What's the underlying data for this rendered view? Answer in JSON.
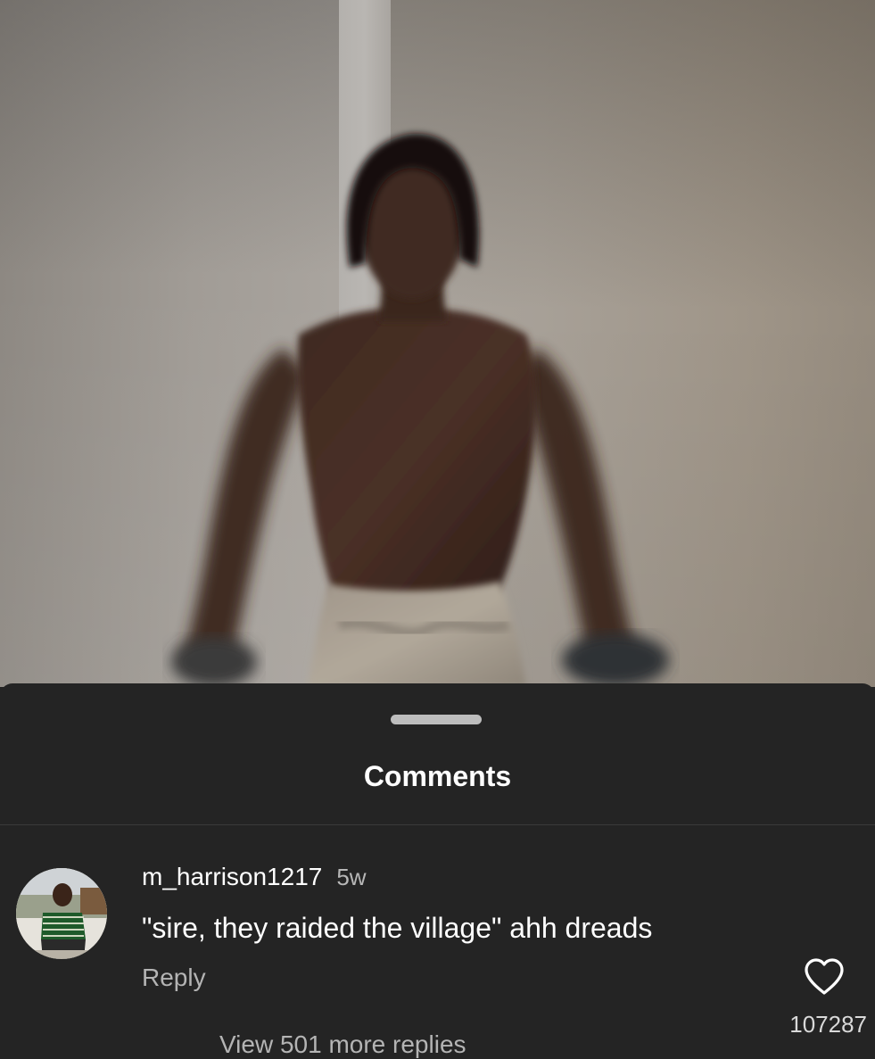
{
  "sheet": {
    "title": "Comments"
  },
  "comments": [
    {
      "username": "m_harrison1217",
      "time": "5w",
      "text": "\"sire, they raided the village\" ahh dreads",
      "reply_label": "Reply",
      "like_count": "107287",
      "like_icon": "heart-outline-icon",
      "view_replies_label": "View 501 more replies"
    }
  ],
  "colors": {
    "sheet_background": "#242424",
    "primary_text": "#ffffff",
    "secondary_text": "#b4b4b4",
    "handle": "#bdbdbd"
  }
}
